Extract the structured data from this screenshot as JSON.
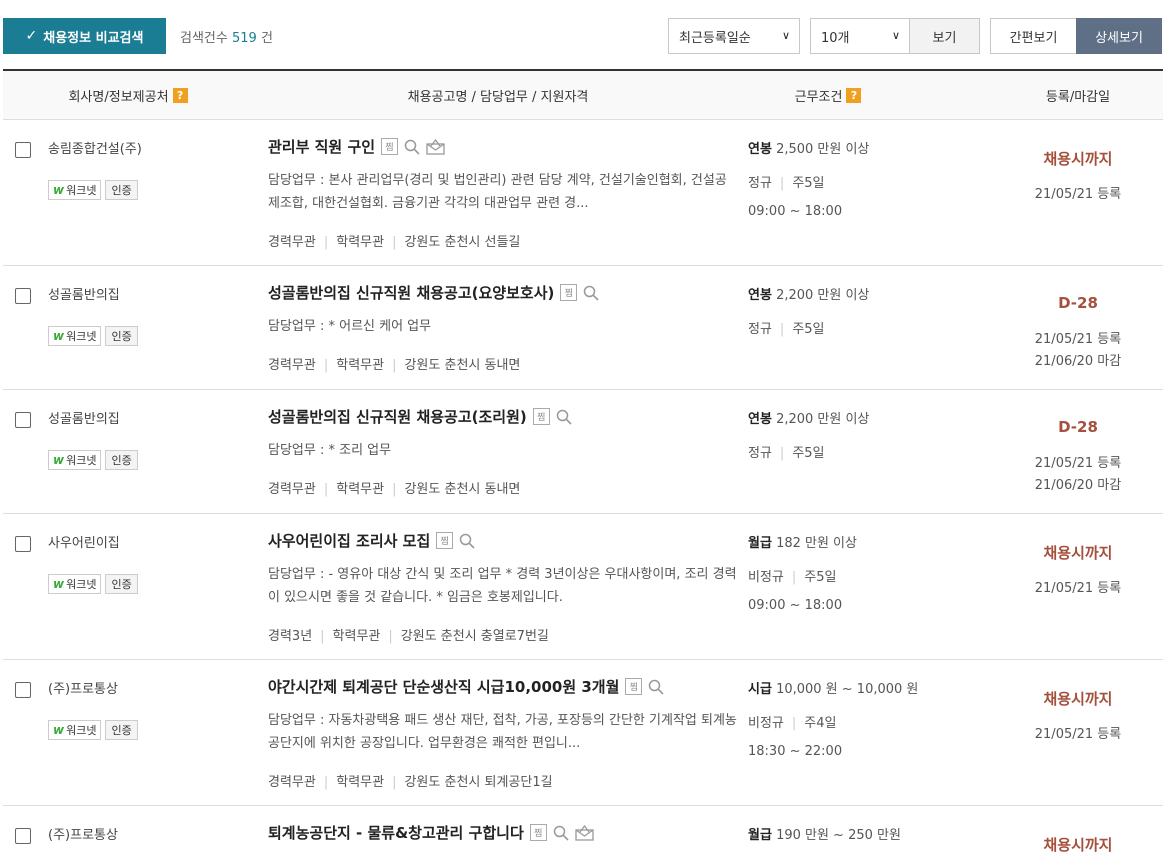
{
  "toolbar": {
    "compare_label": "채용정보 비교검색",
    "count_prefix": "검색건수",
    "count_value": "519",
    "count_suffix": "건",
    "sort_selected": "최근등록일순",
    "per_page_selected": "10개",
    "view_label": "보기",
    "simple_view_label": "간편보기",
    "detail_view_label": "상세보기"
  },
  "columns": {
    "company": "회사명/정보제공처",
    "posting": "채용공고명 / 담당업무 / 지원자격",
    "conditions": "근무조건",
    "dates": "등록/마감일"
  },
  "labels": {
    "worknet": "워크넷",
    "certified": "인증",
    "bookmark_icon_text": "찜"
  },
  "colors": {
    "accent": "#1b7d93",
    "deadline": "#a4503c",
    "help_badge": "#f0a020",
    "active_view": "#5f7086"
  },
  "rows": [
    {
      "company": "송림종합건설(주)",
      "title": "관리부 직원 구인",
      "icons": [
        "bookmark-icon",
        "search-icon",
        "mail-icon"
      ],
      "duty": "담당업무 : 본사 관리업무(경리 및 법인관리) 관련 담당 계약, 건설기술인협회, 건설공제조합, 대한건설협회. 금융기관 각각의 대관업무 관련 경...",
      "career": "경력무관",
      "education": "학력무관",
      "location": "강원도 춘천시 선들길",
      "pay_type": "연봉",
      "pay": "2,500 만원 이상",
      "employment": "정규",
      "week": "주5일",
      "hours": "09:00 ~ 18:00",
      "deadline": "채용시까지",
      "registered": "21/05/21 등록",
      "closing": ""
    },
    {
      "company": "성골롬반의집",
      "title": "성골롬반의집 신규직원 채용공고(요양보호사)",
      "icons": [
        "bookmark-icon",
        "search-icon"
      ],
      "duty": "담당업무 : * 어르신 케어 업무",
      "career": "경력무관",
      "education": "학력무관",
      "location": "강원도 춘천시 동내면",
      "pay_type": "연봉",
      "pay": "2,200 만원 이상",
      "employment": "정규",
      "week": "주5일",
      "hours": "",
      "deadline": "D-28",
      "registered": "21/05/21 등록",
      "closing": "21/06/20 마감"
    },
    {
      "company": "성골롬반의집",
      "title": "성골롬반의집 신규직원 채용공고(조리원)",
      "icons": [
        "bookmark-icon",
        "search-icon"
      ],
      "duty": "담당업무 : * 조리 업무",
      "career": "경력무관",
      "education": "학력무관",
      "location": "강원도 춘천시 동내면",
      "pay_type": "연봉",
      "pay": "2,200 만원 이상",
      "employment": "정규",
      "week": "주5일",
      "hours": "",
      "deadline": "D-28",
      "registered": "21/05/21 등록",
      "closing": "21/06/20 마감"
    },
    {
      "company": "사우어린이집",
      "title": "사우어린이집 조리사 모집",
      "icons": [
        "bookmark-icon",
        "search-icon"
      ],
      "duty": "담당업무 : - 영유아 대상 간식 및 조리 업무 * 경력 3년이상은 우대사항이며, 조리 경력이 있으시면 좋을 것 같습니다. * 임금은 호봉제입니다.",
      "career": "경력3년",
      "education": "학력무관",
      "location": "강원도 춘천시 충열로7번길",
      "pay_type": "월급",
      "pay": "182 만원 이상",
      "employment": "비정규",
      "week": "주5일",
      "hours": "09:00 ~ 18:00",
      "deadline": "채용시까지",
      "registered": "21/05/21 등록",
      "closing": ""
    },
    {
      "company": "(주)프로통상",
      "title": "야간시간제 퇴계공단 단순생산직 시급10,000원 3개월",
      "icons": [
        "bookmark-icon",
        "search-icon"
      ],
      "duty": "담당업무 : 자동차광택용 패드 생산 재단, 접착, 가공, 포장등의 간단한 기계작업 퇴계농공단지에 위치한 공장입니다. 업무환경은 쾌적한 편입니...",
      "career": "경력무관",
      "education": "학력무관",
      "location": "강원도 춘천시 퇴계공단1길",
      "pay_type": "시급",
      "pay": "10,000 원 ~ 10,000 원",
      "employment": "비정규",
      "week": "주4일",
      "hours": "18:30 ~ 22:00",
      "deadline": "채용시까지",
      "registered": "21/05/21 등록",
      "closing": ""
    },
    {
      "company": "(주)프로통상",
      "title": "퇴계농공단지 - 물류&창고관리 구합니다",
      "icons": [
        "bookmark-icon",
        "search-icon",
        "mail-icon"
      ],
      "duty": "",
      "career": "",
      "education": "",
      "location": "",
      "pay_type": "월급",
      "pay": "190 만원 ~ 250 만원",
      "employment": "",
      "week": "",
      "hours": "",
      "deadline": "채용시까지",
      "registered": "",
      "closing": ""
    }
  ]
}
